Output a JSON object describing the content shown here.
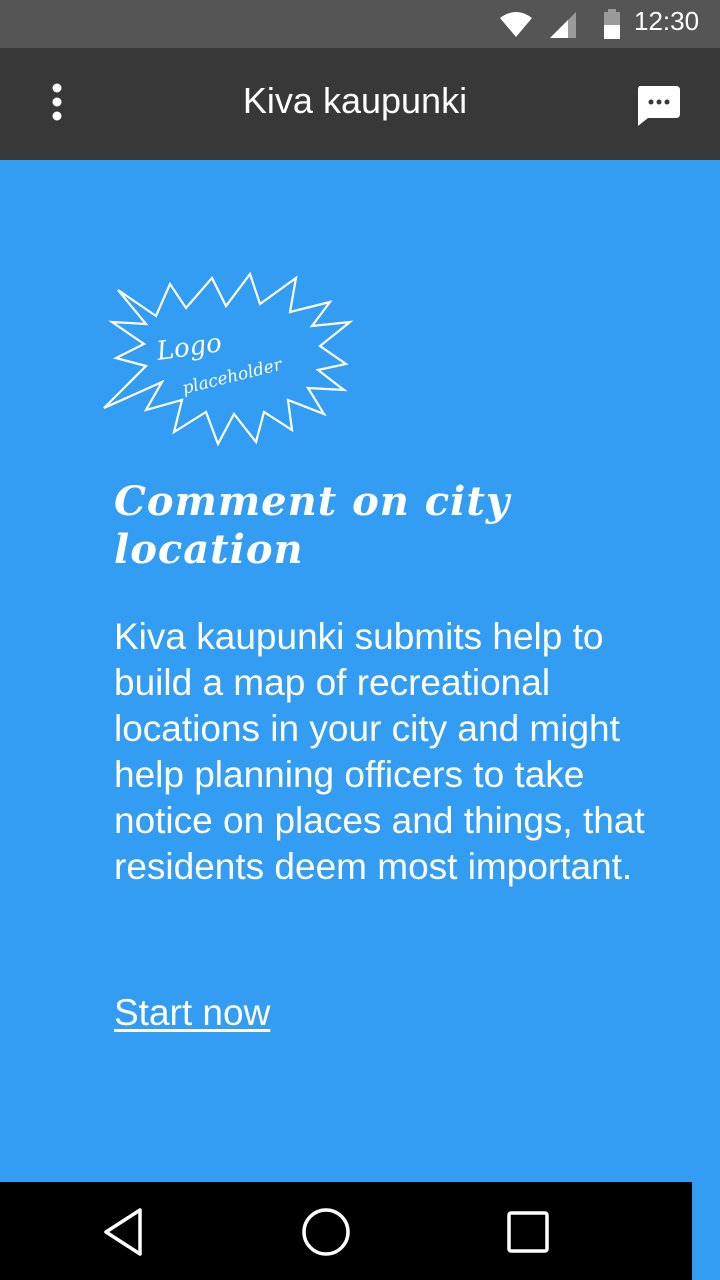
{
  "status_bar": {
    "time": "12:30",
    "icons": [
      "wifi-icon",
      "cell-signal-icon",
      "battery-icon"
    ]
  },
  "app_bar": {
    "title": "Kiva kaupunki",
    "menu_icon": "more-vert-icon",
    "action_icon": "chat-bubble-icon"
  },
  "logo": {
    "line1": "Logo",
    "line2": "placeholder"
  },
  "main": {
    "headline": "Comment on city location",
    "description": "Kiva kaupunki submits help to build a map of recreational locations in your city and might help planning officers to take notice on places and things, that residents deem most important.",
    "cta_label": "Start now"
  },
  "nav_bar": {
    "icons": [
      "back-icon",
      "home-icon",
      "recents-icon"
    ]
  },
  "colors": {
    "background": "#339df3",
    "app_bar": "#383838",
    "status_bar": "#555555",
    "nav_bar": "#000000",
    "text": "#ffffff"
  }
}
